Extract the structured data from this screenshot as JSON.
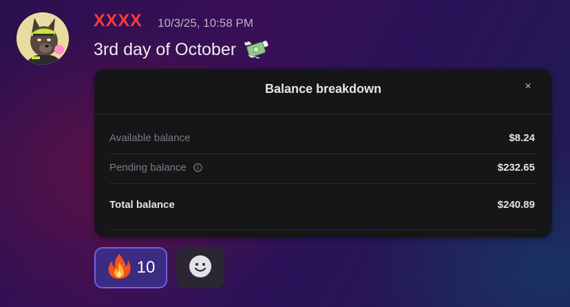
{
  "message": {
    "username": "XXXX",
    "timestamp": "10/3/25, 10:58 PM",
    "text": "3rd day of October",
    "avatar": "wolf-avatar",
    "emoji": "money-with-wings-icon",
    "username_color": "#ff3b3b"
  },
  "balance_card": {
    "title": "Balance breakdown",
    "close_icon": "×",
    "rows": [
      {
        "label": "Available balance",
        "value": "$8.24",
        "info_icon": false
      },
      {
        "label": "Pending balance",
        "value": "$232.65",
        "info_icon": true
      },
      {
        "label": "Total balance",
        "value": "$240.89",
        "info_icon": false
      }
    ]
  },
  "reactions": [
    {
      "emoji": "fire-icon",
      "count": "10",
      "active": true,
      "accent": "#6f63e0"
    }
  ],
  "add_reaction": {
    "icon": "smiley-icon"
  }
}
